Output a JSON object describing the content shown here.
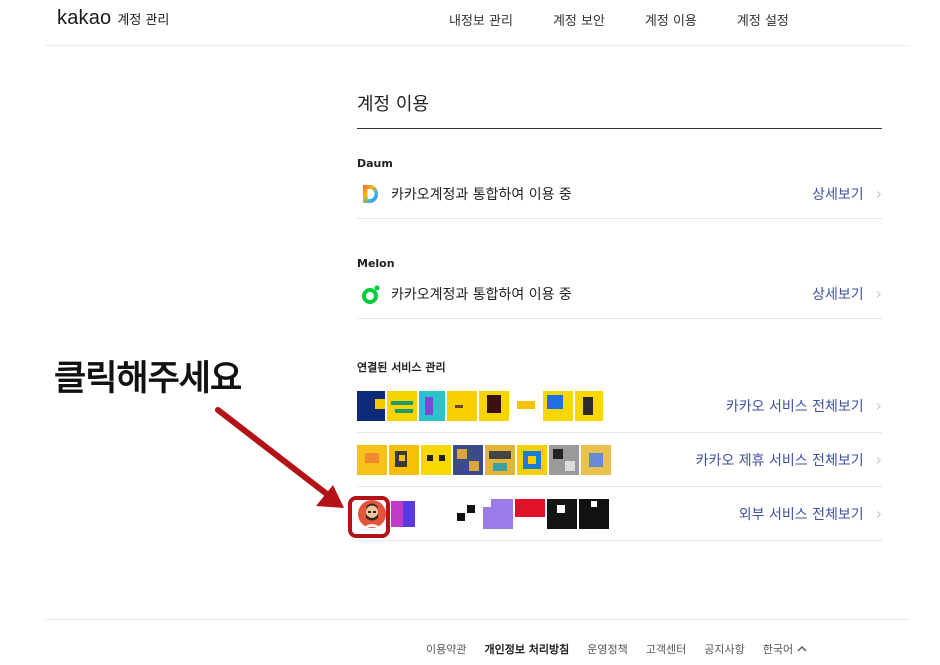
{
  "header": {
    "brand": "kakao",
    "subtitle": "계정 관리",
    "nav": [
      "내정보 관리",
      "계정 보안",
      "계정 이용",
      "계정 설정"
    ]
  },
  "main": {
    "title": "계정 이용",
    "services": [
      {
        "label": "Daum",
        "status": "카카오계정과 통합하여 이용 중",
        "more": "상세보기",
        "icon": "daum-logo-icon"
      },
      {
        "label": "Melon",
        "status": "카카오계정과 통합하여 이용 중",
        "more": "상세보기",
        "icon": "melon-logo-icon"
      }
    ],
    "connected": {
      "label": "연결된 서비스 관리",
      "rows": [
        {
          "more": "카카오 서비스 전체보기"
        },
        {
          "more": "카카오 제휴 서비스 전체보기"
        },
        {
          "more": "외부 서비스 전체보기"
        }
      ]
    }
  },
  "annotation": {
    "callout": "클릭해주세요",
    "accent": "#b31217"
  },
  "footer": {
    "links": [
      "이용약관",
      "개인정보 처리방침",
      "운영정책",
      "고객센터",
      "공지사항"
    ],
    "language": "한국어"
  },
  "colors": {
    "link": "#3f51a3",
    "divider": "#e6e6e6"
  }
}
